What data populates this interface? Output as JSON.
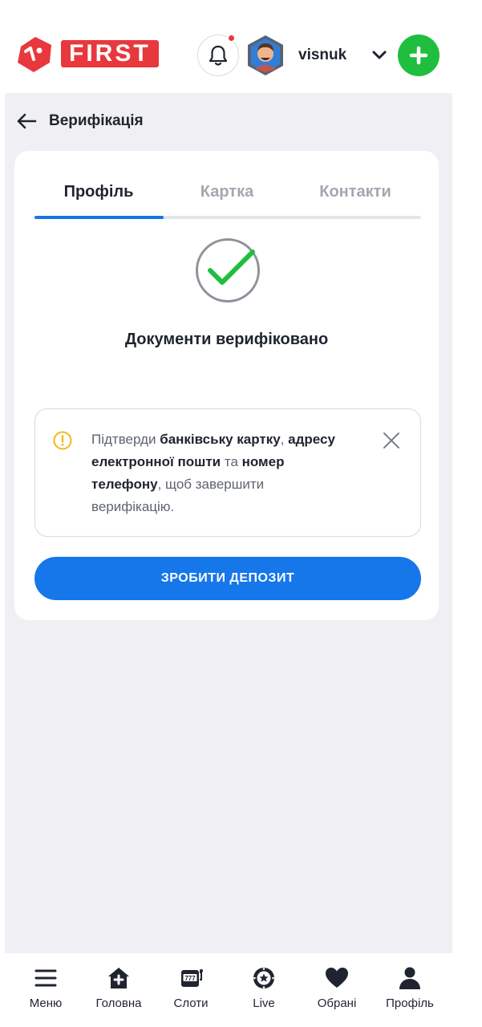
{
  "header": {
    "logo_text": "FIRST",
    "username": "visnuk"
  },
  "page": {
    "title": "Верифікація"
  },
  "tabs": [
    {
      "label": "Профіль",
      "active": true
    },
    {
      "label": "Картка",
      "active": false
    },
    {
      "label": "Контакти",
      "active": false
    }
  ],
  "status": {
    "text": "Документи верифіковано"
  },
  "notice": {
    "part1": "Підтверди ",
    "bold1": "банківську картку",
    "part2": ", ",
    "bold2": "адресу електронної пошти",
    "part3": " та ",
    "bold3": "номер телефону",
    "part4": ", щоб завершити верифікацію."
  },
  "deposit_button": "ЗРОБИТИ ДЕПОЗИТ",
  "bottom_nav": [
    {
      "label": "Меню",
      "icon": "menu-icon"
    },
    {
      "label": "Головна",
      "icon": "home-icon"
    },
    {
      "label": "Слоти",
      "icon": "slots-icon"
    },
    {
      "label": "Live",
      "icon": "live-icon"
    },
    {
      "label": "Обрані",
      "icon": "heart-icon"
    },
    {
      "label": "Профіль",
      "icon": "user-icon"
    }
  ],
  "colors": {
    "brand_red": "#e8383d",
    "accent_blue": "#1577ea",
    "success_green": "#1fbe3e",
    "warning_yellow": "#f2b81b"
  }
}
